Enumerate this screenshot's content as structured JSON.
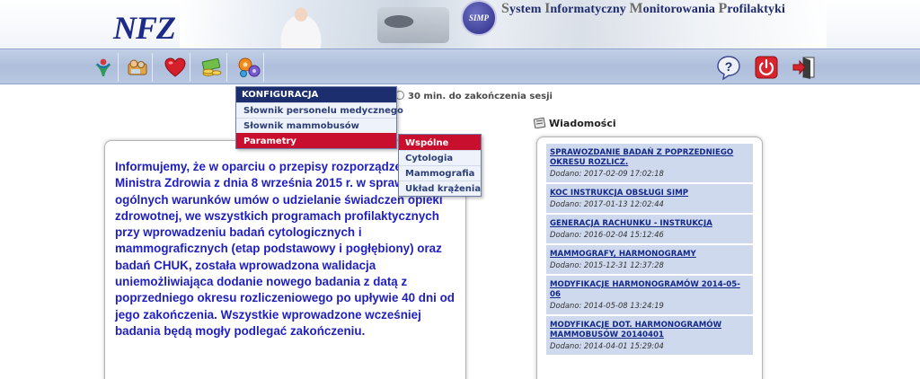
{
  "header": {
    "logo": "NFZ",
    "badge": "SIMP",
    "system_title_parts": [
      {
        "cap": "S",
        "rest": "ystem "
      },
      {
        "cap": "I",
        "rest": "nformatyczny "
      },
      {
        "cap": "M",
        "rest": "onitorowania "
      },
      {
        "cap": "P",
        "rest": "rofilaktyki"
      }
    ]
  },
  "toolbar": {
    "left_icons": [
      "person-icon",
      "patients-icon",
      "heart-icon",
      "money-icon",
      "settings-gears-icon"
    ],
    "right_icons": [
      "help-icon",
      "power-icon",
      "logout-icon"
    ]
  },
  "session": {
    "text": "30 min. do zakończenia sesji"
  },
  "menu": {
    "header": "KONFIGURACJA",
    "items": [
      "Słownik personelu medycznego",
      "Słownik mammobusów",
      "Parametry"
    ],
    "active_item": "Parametry",
    "submenu": [
      "Wspólne",
      "Cytologia",
      "Mammografia",
      "Układ krążenia"
    ],
    "submenu_active": "Wspólne"
  },
  "info": {
    "text": "Informujemy, że w oparciu o przepisy rozporządzenia Ministra Zdrowia z dnia 8 września 2015 r. w sprawie ogólnych warunków umów o udzielanie świadczeń opieki zdrowotnej, we wszystkich programach profilaktycznych przy wprowadzeniu badań cytologicznych i mammograficznych (etap podstawowy i pogłębiony) oraz badań CHUK, została wprowadzona walidacja uniemożliwiająca dodanie nowego badania z datą z poprzedniego okresu rozliczeniowego po upływie 40 dni od jego zakończenia. Wszystkie wprowadzone wcześniej badania będą mogły podlegać zakończeniu."
  },
  "news": {
    "title": "Wiadomości",
    "items": [
      {
        "title": "SPRAWOZDANIE BADAŃ Z POPRZEDNIEGO OKRESU ROZLICZ.",
        "date": "Dodano: 2017-02-09  17:02:18"
      },
      {
        "title": "KOC INSTRUKCJA OBSŁUGI SIMP",
        "date": "Dodano: 2017-01-13  12:02:44"
      },
      {
        "title": "GENERACJA RACHUNKU - INSTRUKCJA",
        "date": "Dodano: 2016-02-04  15:12:46"
      },
      {
        "title": "MAMMOGRAFY, HARMONOGRAMY",
        "date": "Dodano: 2015-12-31  12:37:28"
      },
      {
        "title": "MODYFIKACJE HARMONOGRAMÓW 2014-05-06",
        "date": "Dodano: 2014-05-08  13:24:19"
      },
      {
        "title": "MODYFIKACJE DOT. HARMONOGRAMÓW MAMMOBUSÓW 20140401",
        "date": "Dodano: 2014-04-01  15:29:04"
      }
    ]
  },
  "colors": {
    "menu_header": "#1d2e6e",
    "menu_active": "#c8102e",
    "info_text": "#1f1fbf",
    "news_bg": "#cfd9ee",
    "news_title": "#12288a"
  }
}
